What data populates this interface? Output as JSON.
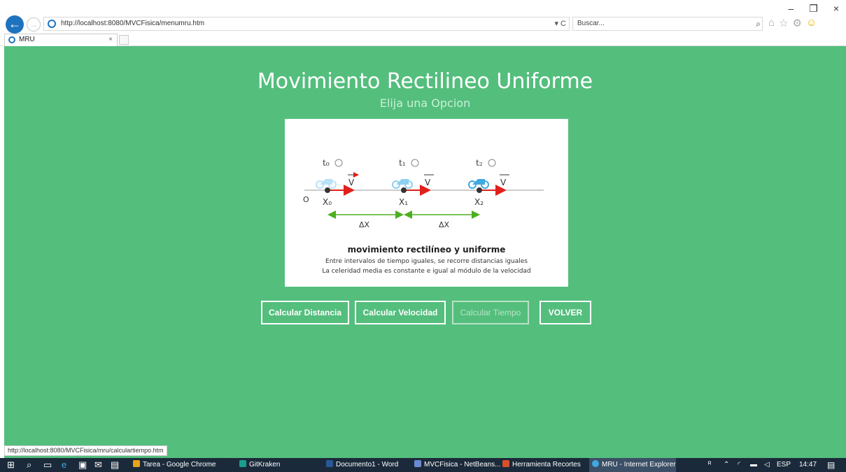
{
  "browser": {
    "url": "http://localhost:8080/MVCFisica/menumru.htm",
    "address_controls": "▾ C",
    "search_placeholder": "Buscar...",
    "tab_title": "MRU",
    "tab_close": "×",
    "window_controls": [
      "–",
      "❐",
      "×"
    ]
  },
  "page": {
    "title": "Movimiento Rectilineo Uniforme",
    "subtitle": "Elija una Opcion",
    "figure": {
      "origin_label": "O",
      "times": [
        "t₀",
        "t₁",
        "t₂"
      ],
      "positions": [
        "X₀",
        "X₁",
        "X₂"
      ],
      "velocity_label": "V",
      "delta_label": "ΔX",
      "caption_title": "movimiento rectilíneo y uniforme",
      "caption_line1": "Entre intervalos de tiempo iguales, se recorre distancias iguales",
      "caption_line2": "La celeridad media es constante e igual al módulo de la velocidad"
    },
    "buttons": {
      "distance": "Calcular Distancia",
      "velocity": "Calcular Velocidad",
      "time": "Calcular Tiempo",
      "back": "VOLVER"
    }
  },
  "statusbar": {
    "text": "http://localhost:8080/MVCFisica/mru/calculartiempo.htm"
  },
  "taskbar": {
    "items": [
      "Tarea - Google Chrome",
      "GitKraken",
      "Documento1 - Word",
      "MVCFisica - NetBeans...",
      "Herramienta Recortes",
      "MRU - Internet Explorer"
    ],
    "language": "ESP",
    "time": "14:47"
  },
  "colors": {
    "page_bg": "#54be7d",
    "velocity_arrow": "#e0201b",
    "delta_arrow": "#4caf20",
    "moto_faded": "#b8e2f6",
    "moto_mid": "#8cd0f0",
    "moto_solid": "#3fa9e0"
  }
}
